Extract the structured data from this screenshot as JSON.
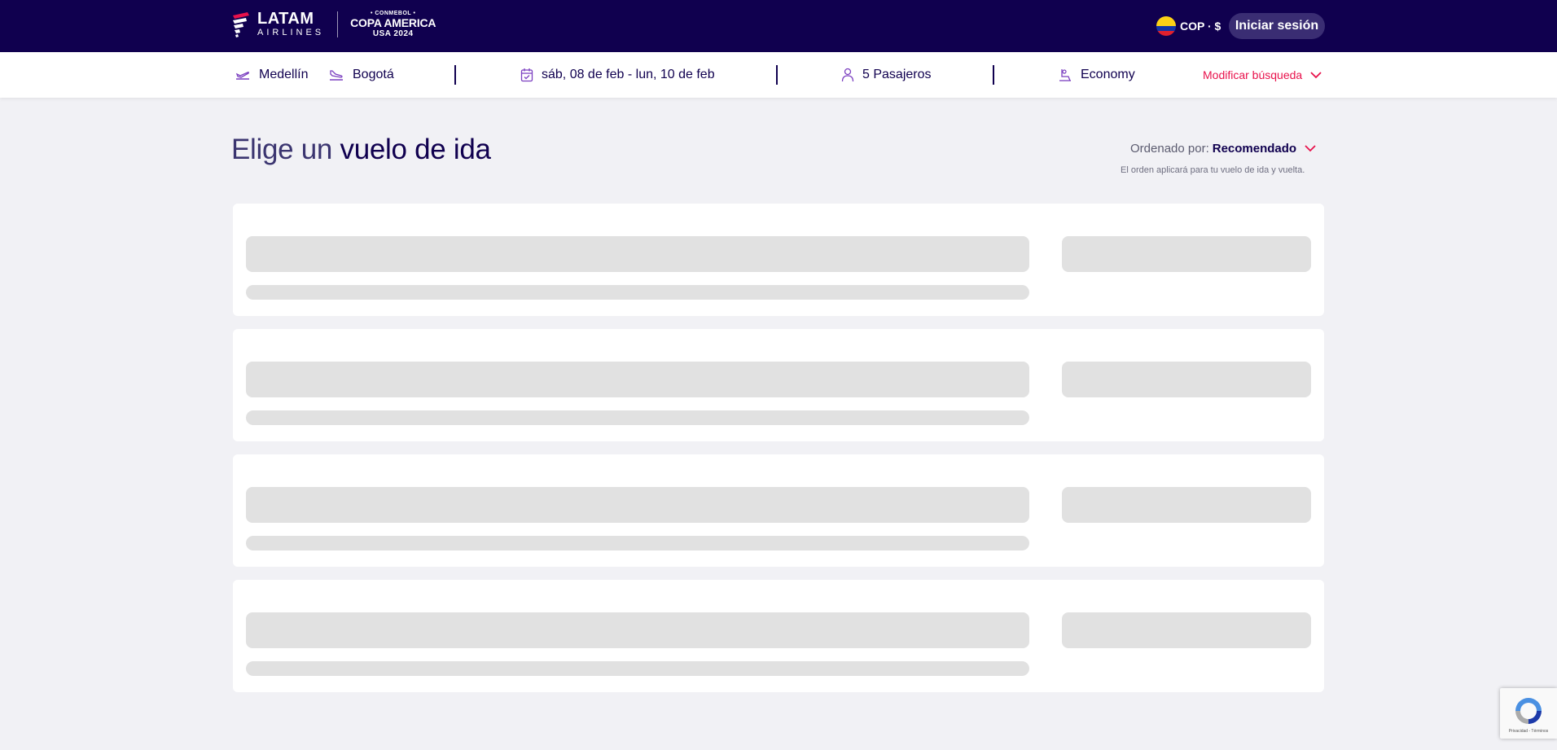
{
  "header": {
    "brand": "LATAM",
    "brand_sub": "AIRLINES",
    "partner": {
      "line1": "• CONMEBOL •",
      "line2": "COPA AMERICA",
      "line3": "USA 2024"
    },
    "currency": "COP · $",
    "login_label": "Iniciar sesión"
  },
  "search": {
    "origin": "Medellín",
    "destination": "Bogotá",
    "dates": "sáb, 08 de feb - lun, 10 de feb",
    "passengers": "5 Pasajeros",
    "cabin": "Economy",
    "modify_label": "Modificar búsqueda"
  },
  "main": {
    "title_part1": "Elige un ",
    "title_part2": "vuelo de ida",
    "sort_label": "Ordenado por:",
    "sort_value": "Recomendado",
    "sort_note": "El orden aplicará para tu vuelo de ida y vuelta.",
    "loading_cards": 4
  },
  "recaptcha": {
    "footer": "Privacidad - Términos"
  },
  "colors": {
    "primary": "#10004f",
    "accent": "#e8114b",
    "background": "#f1f1f5",
    "skeleton": "#e1e1e1"
  }
}
